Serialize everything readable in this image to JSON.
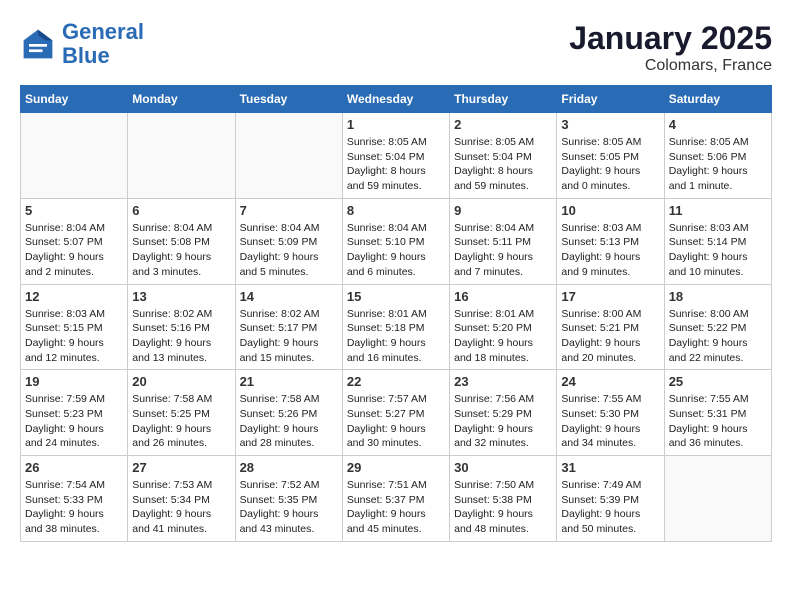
{
  "header": {
    "logo_line1": "General",
    "logo_line2": "Blue",
    "month": "January 2025",
    "location": "Colomars, France"
  },
  "days_of_week": [
    "Sunday",
    "Monday",
    "Tuesday",
    "Wednesday",
    "Thursday",
    "Friday",
    "Saturday"
  ],
  "weeks": [
    {
      "days": [
        {
          "num": "",
          "content": ""
        },
        {
          "num": "",
          "content": ""
        },
        {
          "num": "",
          "content": ""
        },
        {
          "num": "1",
          "content": "Sunrise: 8:05 AM\nSunset: 5:04 PM\nDaylight: 8 hours and 59 minutes."
        },
        {
          "num": "2",
          "content": "Sunrise: 8:05 AM\nSunset: 5:04 PM\nDaylight: 8 hours and 59 minutes."
        },
        {
          "num": "3",
          "content": "Sunrise: 8:05 AM\nSunset: 5:05 PM\nDaylight: 9 hours and 0 minutes."
        },
        {
          "num": "4",
          "content": "Sunrise: 8:05 AM\nSunset: 5:06 PM\nDaylight: 9 hours and 1 minute."
        }
      ]
    },
    {
      "days": [
        {
          "num": "5",
          "content": "Sunrise: 8:04 AM\nSunset: 5:07 PM\nDaylight: 9 hours and 2 minutes."
        },
        {
          "num": "6",
          "content": "Sunrise: 8:04 AM\nSunset: 5:08 PM\nDaylight: 9 hours and 3 minutes."
        },
        {
          "num": "7",
          "content": "Sunrise: 8:04 AM\nSunset: 5:09 PM\nDaylight: 9 hours and 5 minutes."
        },
        {
          "num": "8",
          "content": "Sunrise: 8:04 AM\nSunset: 5:10 PM\nDaylight: 9 hours and 6 minutes."
        },
        {
          "num": "9",
          "content": "Sunrise: 8:04 AM\nSunset: 5:11 PM\nDaylight: 9 hours and 7 minutes."
        },
        {
          "num": "10",
          "content": "Sunrise: 8:03 AM\nSunset: 5:13 PM\nDaylight: 9 hours and 9 minutes."
        },
        {
          "num": "11",
          "content": "Sunrise: 8:03 AM\nSunset: 5:14 PM\nDaylight: 9 hours and 10 minutes."
        }
      ]
    },
    {
      "days": [
        {
          "num": "12",
          "content": "Sunrise: 8:03 AM\nSunset: 5:15 PM\nDaylight: 9 hours and 12 minutes."
        },
        {
          "num": "13",
          "content": "Sunrise: 8:02 AM\nSunset: 5:16 PM\nDaylight: 9 hours and 13 minutes."
        },
        {
          "num": "14",
          "content": "Sunrise: 8:02 AM\nSunset: 5:17 PM\nDaylight: 9 hours and 15 minutes."
        },
        {
          "num": "15",
          "content": "Sunrise: 8:01 AM\nSunset: 5:18 PM\nDaylight: 9 hours and 16 minutes."
        },
        {
          "num": "16",
          "content": "Sunrise: 8:01 AM\nSunset: 5:20 PM\nDaylight: 9 hours and 18 minutes."
        },
        {
          "num": "17",
          "content": "Sunrise: 8:00 AM\nSunset: 5:21 PM\nDaylight: 9 hours and 20 minutes."
        },
        {
          "num": "18",
          "content": "Sunrise: 8:00 AM\nSunset: 5:22 PM\nDaylight: 9 hours and 22 minutes."
        }
      ]
    },
    {
      "days": [
        {
          "num": "19",
          "content": "Sunrise: 7:59 AM\nSunset: 5:23 PM\nDaylight: 9 hours and 24 minutes."
        },
        {
          "num": "20",
          "content": "Sunrise: 7:58 AM\nSunset: 5:25 PM\nDaylight: 9 hours and 26 minutes."
        },
        {
          "num": "21",
          "content": "Sunrise: 7:58 AM\nSunset: 5:26 PM\nDaylight: 9 hours and 28 minutes."
        },
        {
          "num": "22",
          "content": "Sunrise: 7:57 AM\nSunset: 5:27 PM\nDaylight: 9 hours and 30 minutes."
        },
        {
          "num": "23",
          "content": "Sunrise: 7:56 AM\nSunset: 5:29 PM\nDaylight: 9 hours and 32 minutes."
        },
        {
          "num": "24",
          "content": "Sunrise: 7:55 AM\nSunset: 5:30 PM\nDaylight: 9 hours and 34 minutes."
        },
        {
          "num": "25",
          "content": "Sunrise: 7:55 AM\nSunset: 5:31 PM\nDaylight: 9 hours and 36 minutes."
        }
      ]
    },
    {
      "days": [
        {
          "num": "26",
          "content": "Sunrise: 7:54 AM\nSunset: 5:33 PM\nDaylight: 9 hours and 38 minutes."
        },
        {
          "num": "27",
          "content": "Sunrise: 7:53 AM\nSunset: 5:34 PM\nDaylight: 9 hours and 41 minutes."
        },
        {
          "num": "28",
          "content": "Sunrise: 7:52 AM\nSunset: 5:35 PM\nDaylight: 9 hours and 43 minutes."
        },
        {
          "num": "29",
          "content": "Sunrise: 7:51 AM\nSunset: 5:37 PM\nDaylight: 9 hours and 45 minutes."
        },
        {
          "num": "30",
          "content": "Sunrise: 7:50 AM\nSunset: 5:38 PM\nDaylight: 9 hours and 48 minutes."
        },
        {
          "num": "31",
          "content": "Sunrise: 7:49 AM\nSunset: 5:39 PM\nDaylight: 9 hours and 50 minutes."
        },
        {
          "num": "",
          "content": ""
        }
      ]
    }
  ]
}
